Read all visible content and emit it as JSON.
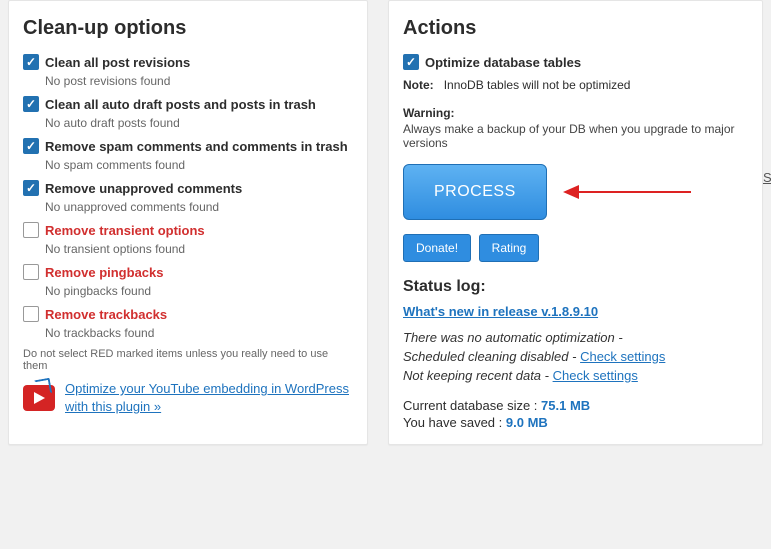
{
  "left": {
    "title": "Clean-up options",
    "options": [
      {
        "label": "Clean all post revisions",
        "sub": "No post revisions found",
        "checked": true,
        "red": false
      },
      {
        "label": "Clean all auto draft posts and posts in trash",
        "sub": "No auto draft posts found",
        "checked": true,
        "red": false
      },
      {
        "label": "Remove spam comments and comments in trash",
        "sub": "No spam comments found",
        "checked": true,
        "red": false
      },
      {
        "label": "Remove unapproved comments",
        "sub": "No unapproved comments found",
        "checked": true,
        "red": false
      },
      {
        "label": "Remove transient options",
        "sub": "No transient options found",
        "checked": false,
        "red": true
      },
      {
        "label": "Remove pingbacks",
        "sub": "No pingbacks found",
        "checked": false,
        "red": true
      },
      {
        "label": "Remove trackbacks",
        "sub": "No trackbacks found",
        "checked": false,
        "red": true
      }
    ],
    "footnote": "Do not select RED marked items unless you really need to use them",
    "yt_link": "Optimize your YouTube embedding in WordPress with this plugin »"
  },
  "right": {
    "title": "Actions",
    "optimize": {
      "label": "Optimize database tables",
      "checked": true
    },
    "note_label": "Note:",
    "note_text": "InnoDB tables will not be optimized",
    "warn_label": "Warning:",
    "warn_text": "Always make a backup of your DB when you upgrade to major versions",
    "process_btn": "PROCESS",
    "donate_btn": "Donate!",
    "rating_btn": "Rating",
    "status_title": "Status log:",
    "whats_new": "What's new in release v.1.8.9.10",
    "auto_line": "There was no automatic optimization -",
    "sched_line": "Scheduled cleaning disabled - ",
    "sched_link": "Check settings",
    "recent_line": "Not keeping recent data - ",
    "recent_link": "Check settings",
    "db_label": "Current database size : ",
    "db_val": "75.1 MB",
    "saved_label": "You have saved : ",
    "saved_val": "9.0 MB"
  },
  "edge_letter": "S"
}
